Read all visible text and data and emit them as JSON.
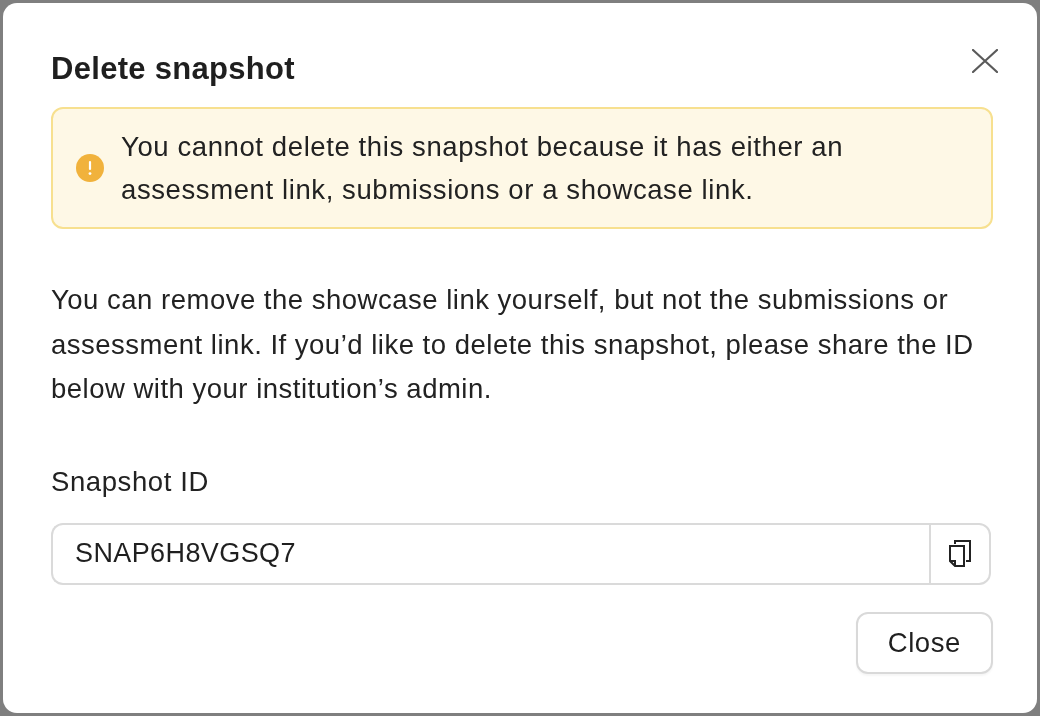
{
  "dialog": {
    "title": "Delete snapshot"
  },
  "alert": {
    "kind": "warning",
    "message": "You cannot delete this snapshot because it has either an assessment link, submissions or a showcase link."
  },
  "description": "You can remove the showcase link yourself, but not the submissions or assessment link. If you’d like to delete this snapshot, please share the ID below with your institution’s admin.",
  "snapshot_id": {
    "label": "Snapshot ID",
    "value": "SNAP6H8VGSQ7"
  },
  "buttons": [
    "Close"
  ]
}
